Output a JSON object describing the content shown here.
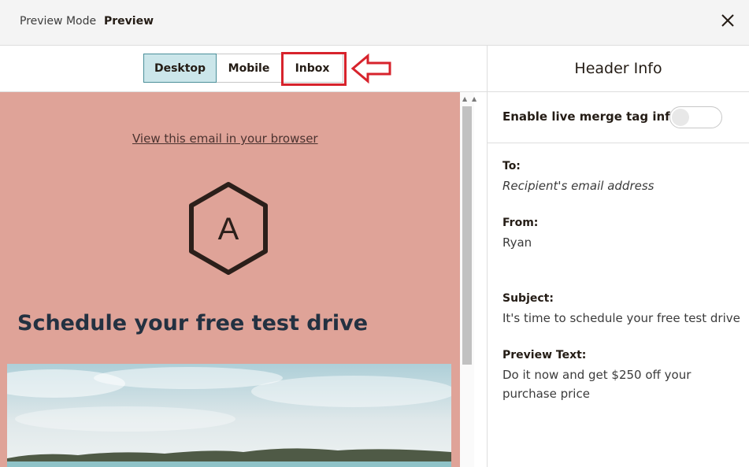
{
  "topbar": {
    "mode_label": "Preview Mode",
    "title": "Preview",
    "close_icon": "close-icon"
  },
  "tabs": [
    {
      "label": "Desktop",
      "active": true
    },
    {
      "label": "Mobile",
      "active": false
    },
    {
      "label": "Inbox",
      "active": false
    }
  ],
  "annotation": {
    "color": "#d7232c",
    "icon": "arrow-left-icon"
  },
  "email": {
    "browser_link": "View this email in your browser",
    "logo_letter": "A",
    "headline": "Schedule your free test drive",
    "background": "#dfa398"
  },
  "panel": {
    "title": "Header Info",
    "merge_label": "Enable live merge tag info",
    "merge_enabled": false,
    "to_label": "To:",
    "to_value": "Recipient's email address",
    "from_label": "From:",
    "from_value": "Ryan",
    "subject_label": "Subject:",
    "subject_value": "It's time to schedule your free test drive",
    "preview_label": "Preview Text:",
    "preview_value": "Do it now and get $250 off your purchase price"
  },
  "colors": {
    "accent_tab": "#cbe6ea",
    "headline": "#233141",
    "highlight": "#d7232c"
  }
}
